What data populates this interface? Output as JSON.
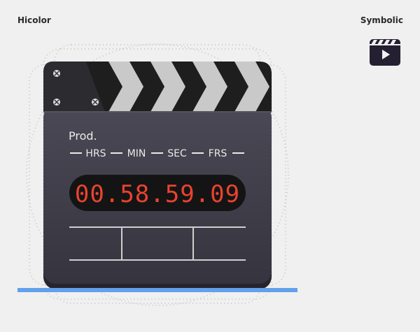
{
  "labels": {
    "hicolor": "Hicolor",
    "symbolic": "Symbolic"
  },
  "clapperboard": {
    "production_label": "Prod.",
    "time_units": [
      "HRS",
      "MIN",
      "SEC",
      "FRS"
    ],
    "timecode": "00.58.59.09"
  },
  "colors": {
    "background": "#f0f0f0",
    "board_body": "#3e3d48",
    "stick_dark": "#1e1e1e",
    "stick_light": "#c9c9c9",
    "display_bg": "#141414",
    "display_digits": "#e8432f",
    "baseline": "#62a0ea",
    "symbolic_icon": "#241f31"
  },
  "icons": {
    "hicolor": "clapperboard-icon",
    "symbolic": "video-play-clapperboard-icon"
  }
}
